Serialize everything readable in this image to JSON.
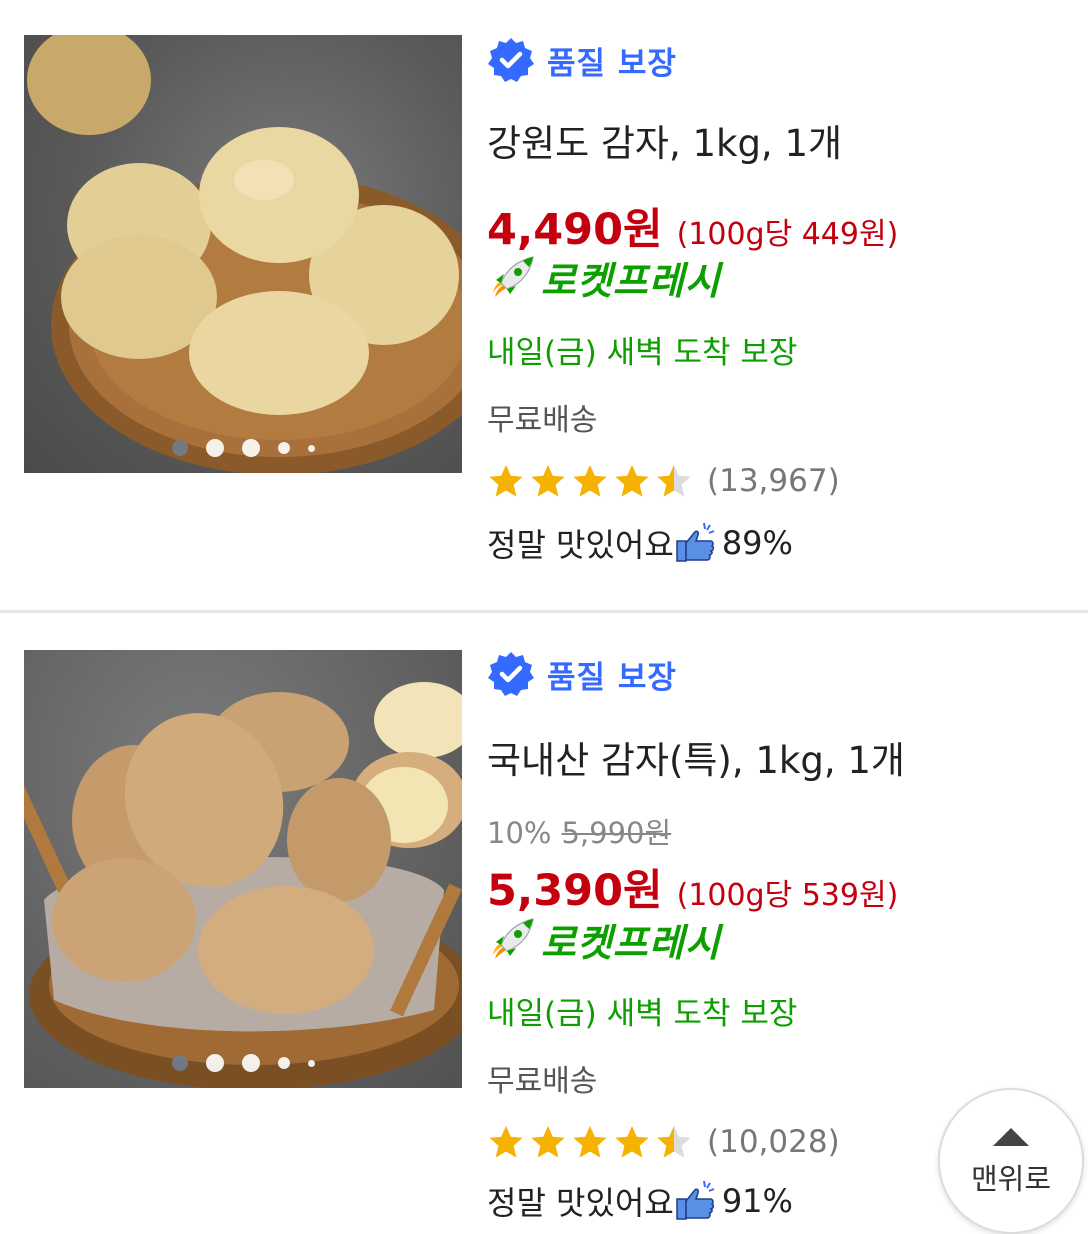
{
  "colors": {
    "quality_blue": "#346aff",
    "price_red": "#c4000f",
    "rocket_green": "#0d9e00",
    "star_yellow": "#f6b200"
  },
  "products": [
    {
      "badge_label": "품질 보장",
      "title": "강원도 감자, 1kg, 1개",
      "price": "4,490원",
      "unit_price": "(100g당 449원)",
      "rocket_label": "로켓프레시",
      "delivery": "내일(금) 새벽 도착 보장",
      "shipping": "무료배송",
      "rating": 4.5,
      "review_count": "(13,967)",
      "taste_label": "정말 맛있어요",
      "taste_percent": "89%",
      "image_page": 1,
      "image_pages": 5
    },
    {
      "badge_label": "품질 보장",
      "title": "국내산 감자(특), 1kg, 1개",
      "discount": "10%",
      "original_price": "5,990원",
      "price": "5,390원",
      "unit_price": "(100g당 539원)",
      "rocket_label": "로켓프레시",
      "delivery": "내일(금) 새벽 도착 보장",
      "shipping": "무료배송",
      "rating": 4.5,
      "review_count": "(10,028)",
      "taste_label": "정말 맛있어요",
      "taste_percent": "91%",
      "image_page": 1,
      "image_pages": 5
    }
  ],
  "scroll_top": {
    "label": "맨위로",
    "icon": "arrow-up-icon"
  }
}
